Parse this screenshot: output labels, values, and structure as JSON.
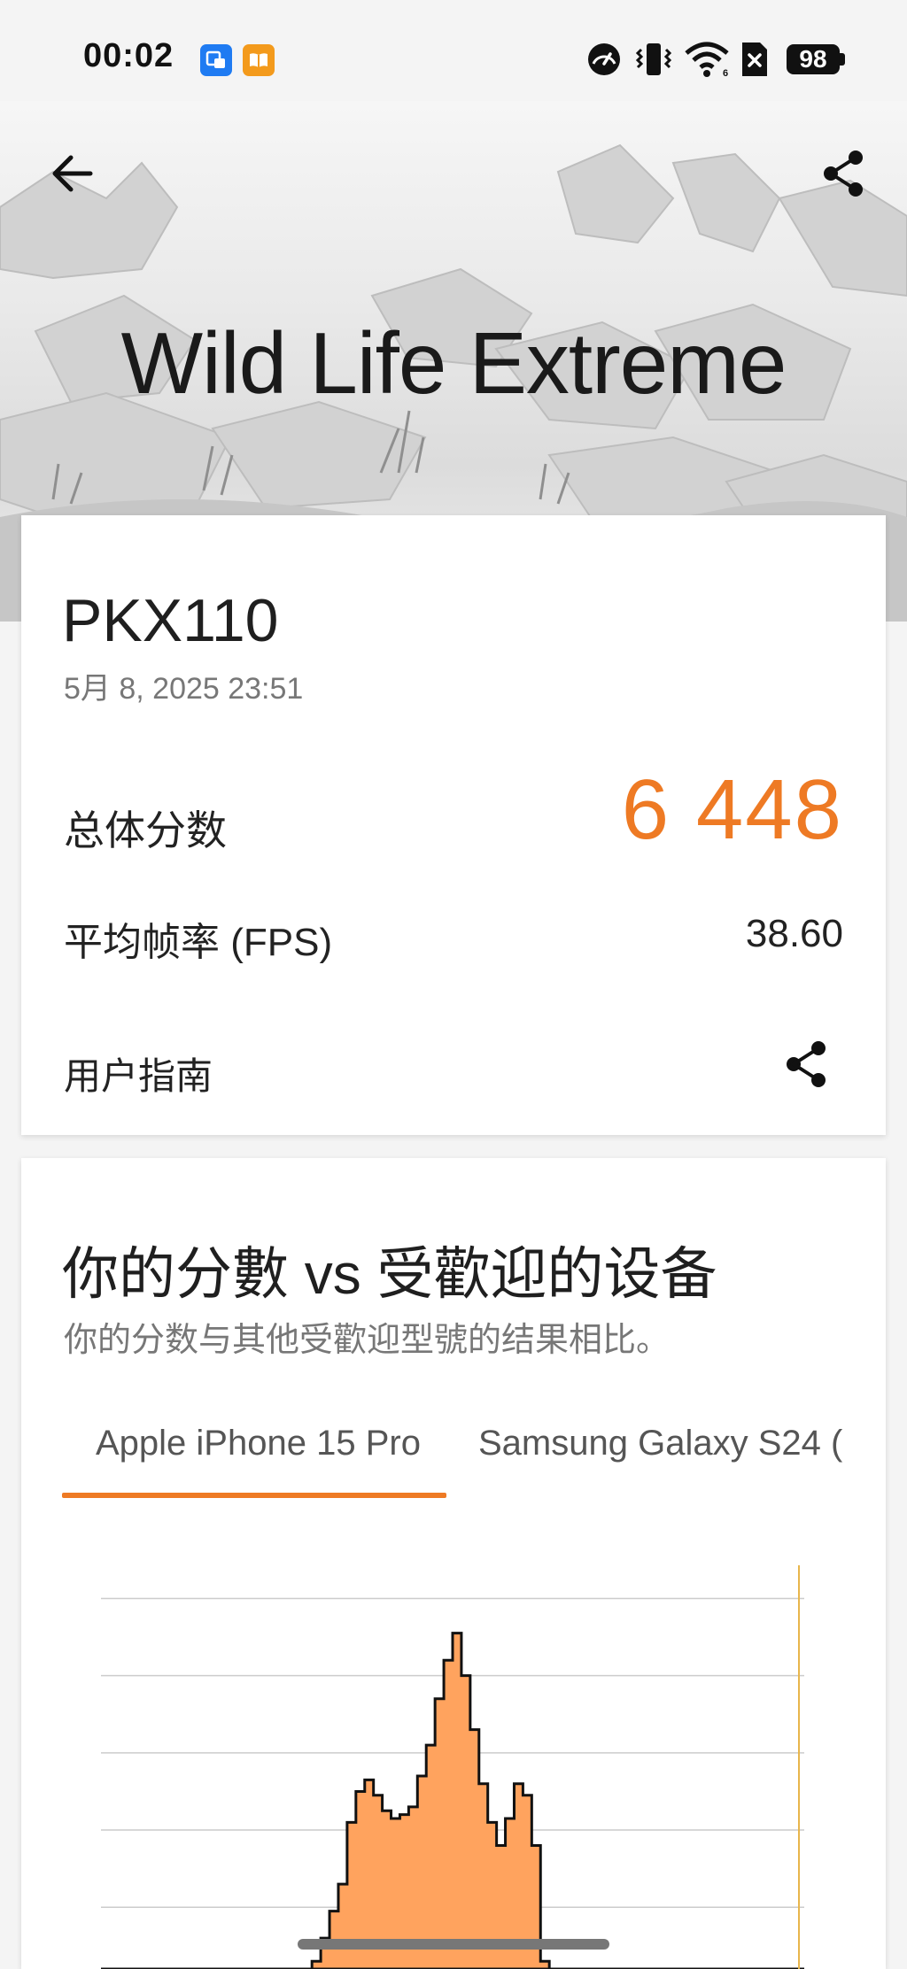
{
  "status_bar": {
    "time": "00:02",
    "battery": "98",
    "icons": [
      "app-notification-icon",
      "book-notification-icon",
      "speedometer-icon",
      "vibrate-icon",
      "wifi-icon",
      "no-sim-icon",
      "battery-icon"
    ]
  },
  "header": {
    "title": "Wild Life Extreme",
    "back_icon": "arrow-left-icon",
    "share_icon": "share-icon"
  },
  "result": {
    "device": "PKX110",
    "date": "5月 8, 2025 23:51",
    "score_label": "总体分数",
    "score_value": "6 448",
    "fps_label": "平均帧率 (FPS)",
    "fps_value": "38.60",
    "guide_label": "用户指南"
  },
  "compare": {
    "title": "你的分數 vs 受歡迎的设备",
    "subtitle": "你的分数与其他受歡迎型號的结果相比。",
    "tabs": [
      {
        "label": "Apple iPhone 15 Pro",
        "selected": true
      },
      {
        "label": "Samsung Galaxy S24 (",
        "selected": false
      }
    ]
  },
  "colors": {
    "accent": "#ee7a24",
    "histogram_fill": "#ffa35e"
  },
  "chart_data": {
    "type": "area",
    "title": "",
    "xlabel": "",
    "ylabel": "",
    "grid": true,
    "series": [
      {
        "values": [
          0,
          0,
          0,
          0,
          0,
          0,
          0,
          0,
          0,
          0,
          0,
          0,
          0,
          0,
          0,
          0,
          0,
          0,
          0,
          0,
          0,
          0,
          0,
          0,
          0.02,
          0.08,
          0.15,
          0.22,
          0.38,
          0.46,
          0.49,
          0.45,
          0.41,
          0.39,
          0.4,
          0.42,
          0.5,
          0.58,
          0.7,
          0.8,
          0.87,
          0.76,
          0.62,
          0.48,
          0.38,
          0.32,
          0.39,
          0.48,
          0.45,
          0.32,
          0.02,
          0,
          0,
          0,
          0,
          0,
          0,
          0,
          0,
          0,
          0,
          0,
          0,
          0,
          0,
          0,
          0,
          0,
          0,
          0,
          0,
          0,
          0,
          0,
          0,
          0,
          0,
          0,
          0,
          0
        ]
      }
    ],
    "marker": {
      "position": "right edge",
      "color": "#e8b64c"
    }
  }
}
